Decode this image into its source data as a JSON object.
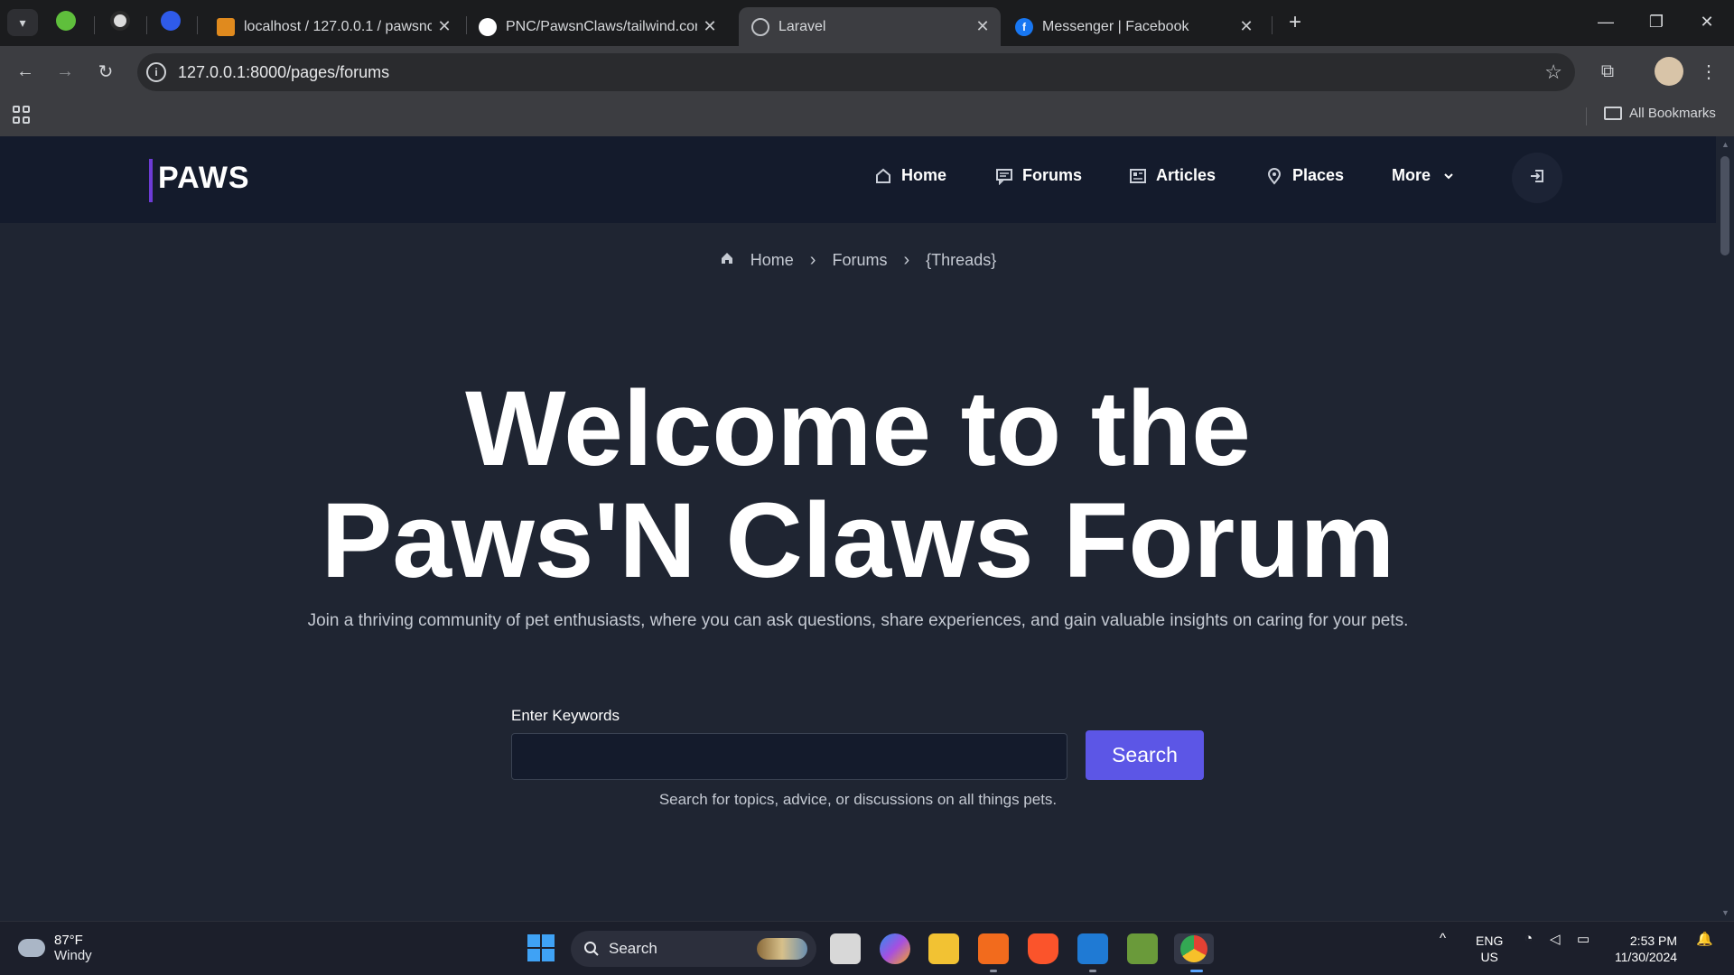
{
  "browser": {
    "tabs": [
      {
        "title": "localhost / 127.0.0.1 / pawsncla",
        "active": false
      },
      {
        "title": "PNC/PawsnClaws/tailwind.confi",
        "active": false
      },
      {
        "title": "Laravel",
        "active": true
      },
      {
        "title": "Messenger | Facebook",
        "active": false
      }
    ],
    "url": "127.0.0.1:8000/pages/forums",
    "bookmarks_label": "All Bookmarks"
  },
  "site": {
    "logo": "PAWS",
    "nav": [
      {
        "label": "Home",
        "icon": "home-icon"
      },
      {
        "label": "Forums",
        "icon": "chat-icon"
      },
      {
        "label": "Articles",
        "icon": "newspaper-icon"
      },
      {
        "label": "Places",
        "icon": "map-pin-icon"
      },
      {
        "label": "More",
        "icon": "chevron-down-icon"
      }
    ]
  },
  "breadcrumb": [
    "Home",
    "Forums",
    "{Threads}"
  ],
  "hero": {
    "title_line1": "Welcome to the",
    "title_line2": "Paws'N Claws Forum",
    "subtitle": "Join a thriving community of pet enthusiasts, where you can ask questions, share experiences, and gain valuable insights on caring for your pets."
  },
  "search": {
    "label": "Enter Keywords",
    "value": "",
    "button": "Search",
    "help": "Search for topics, advice, or discussions on all things pets."
  },
  "taskbar": {
    "weather_temp": "87°F",
    "weather_desc": "Windy",
    "search_label": "Search",
    "lang_line1": "ENG",
    "lang_line2": "US",
    "time": "2:53 PM",
    "date": "11/30/2024"
  },
  "colors": {
    "page_bg": "#1f2532",
    "nav_bg": "#141b2c",
    "accent": "#5c56e6",
    "logo_bar": "#6d3bd6"
  }
}
